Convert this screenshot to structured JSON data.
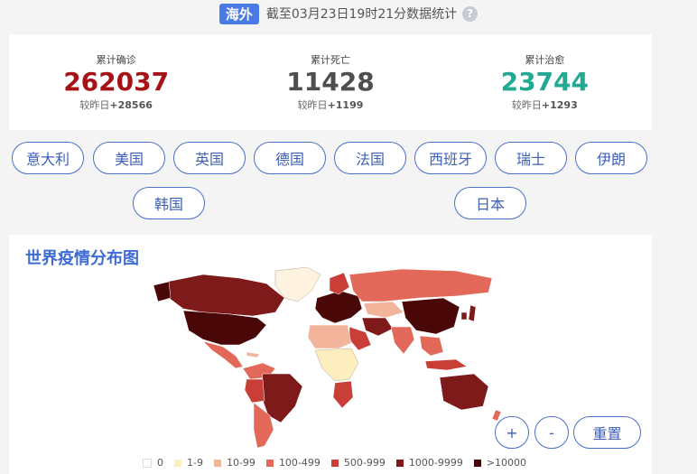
{
  "header": {
    "region": "海外",
    "updated": "截至03月23日19时21分数据统计",
    "help_icon": "?"
  },
  "stats": [
    {
      "label": "累计确诊",
      "value": "262037",
      "delta_prefix": "较昨日",
      "delta": "+28566",
      "color": "#a51317"
    },
    {
      "label": "累计死亡",
      "value": "11428",
      "delta_prefix": "较昨日",
      "delta": "+1199",
      "color": "#4e4e4e"
    },
    {
      "label": "累计治愈",
      "value": "23744",
      "delta_prefix": "较昨日",
      "delta": "+1293",
      "color": "#21a992"
    }
  ],
  "countries": [
    "意大利",
    "美国",
    "英国",
    "德国",
    "法国",
    "西班牙",
    "瑞士",
    "伊朗",
    "韩国",
    "日本"
  ],
  "map": {
    "title": "世界疫情分布图",
    "zoom_in": "+",
    "zoom_out": "-",
    "reset": "重置"
  },
  "legend": [
    {
      "label": "0",
      "color": "#ffffff"
    },
    {
      "label": "1-9",
      "color": "#fdeec0"
    },
    {
      "label": "10-99",
      "color": "#f2b49b"
    },
    {
      "label": "100-499",
      "color": "#e2695a"
    },
    {
      "label": "500-999",
      "color": "#c93f38"
    },
    {
      "label": "1000-9999",
      "color": "#7e1a1a"
    },
    {
      "label": ">10000",
      "color": "#4a0707"
    }
  ]
}
